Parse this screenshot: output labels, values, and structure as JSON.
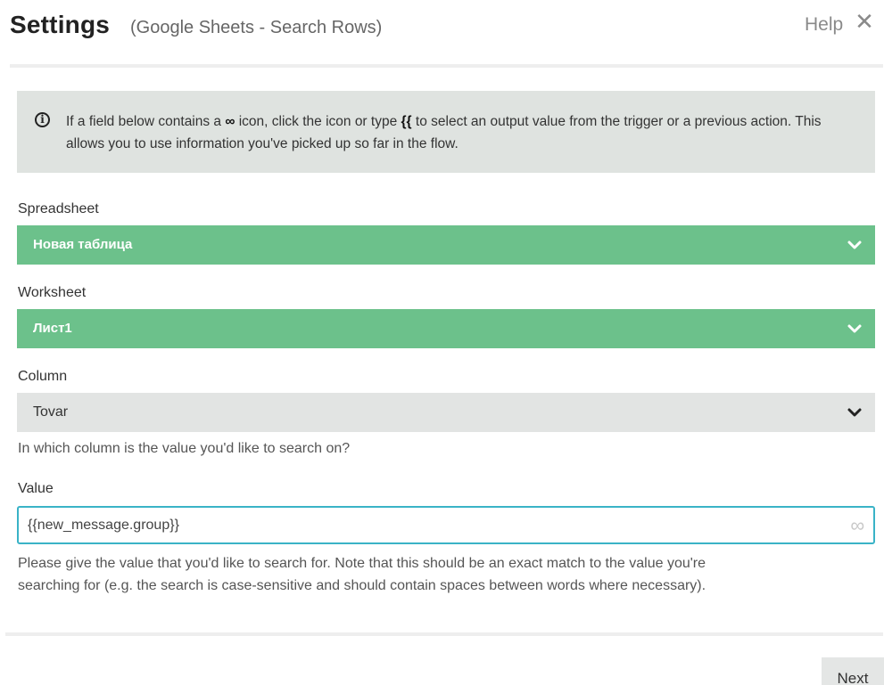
{
  "header": {
    "title": "Settings",
    "subtitle": "(Google Sheets - Search Rows)",
    "help_label": "Help",
    "close_glyph": "✕"
  },
  "info": {
    "icon": "info-circle-icon",
    "text_before_icon": "If a field below contains a ",
    "inline_icon_glyph": "∞",
    "text_after_icon": " icon, click the icon or type ",
    "braces": "{{",
    "text_end": " to select an output value from the trigger or a previous action. This allows you to use information you've picked up so far in the flow."
  },
  "fields": {
    "spreadsheet": {
      "label": "Spreadsheet",
      "value": "Новая таблица"
    },
    "worksheet": {
      "label": "Worksheet",
      "value": "Лист1"
    },
    "column": {
      "label": "Column",
      "value": "Tovar",
      "help": "In which column is the value you'd like to search on?"
    },
    "value": {
      "label": "Value",
      "input_value": "{{new_message.group}}",
      "icon": "infinity-icon",
      "icon_glyph": "∞",
      "help_line1": "Please give the value that you'd like to search for. Note that this should be an exact match to the value you're",
      "help_line2": "searching for (e.g. the search is case-sensitive and should contain spaces between words where necessary)."
    }
  },
  "footer": {
    "next_label": "Next"
  },
  "colors": {
    "select_active": "#6cc18b",
    "select_inactive": "#e2e4e3",
    "info_bg": "#dfe3e0",
    "input_focus_border": "#3ab3c7"
  }
}
